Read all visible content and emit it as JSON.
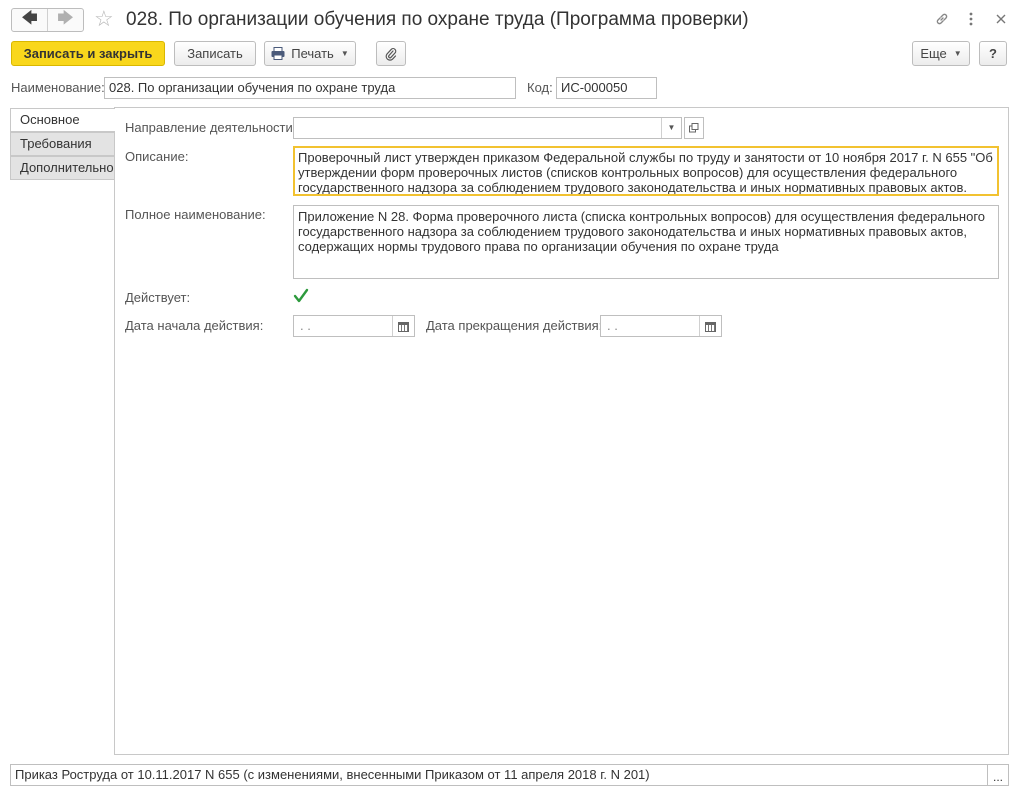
{
  "window": {
    "title": "028. По организации обучения по охране труда (Программа проверки)"
  },
  "icons": {
    "back": "arrow-left-icon",
    "forward": "arrow-right-icon",
    "favorite": "star-icon",
    "link": "link-icon",
    "menu": "more-vertical-icon",
    "close": "close-icon",
    "print": "printer-icon",
    "attach": "paperclip-icon",
    "calendar": "calendar-icon",
    "check": "checkmark-icon"
  },
  "toolbar": {
    "save_close": "Записать и закрыть",
    "save": "Записать",
    "print": "Печать",
    "more": "Еще",
    "help": "?"
  },
  "header": {
    "name_label": "Наименование:",
    "name_value": "028. По организации обучения по охране труда",
    "code_label": "Код:",
    "code_value": "ИС-000050"
  },
  "tabs": [
    {
      "label": "Основное",
      "active": true
    },
    {
      "label": "Требования",
      "active": false
    },
    {
      "label": "Дополнительно",
      "active": false
    }
  ],
  "form": {
    "direction_label": "Направление деятельности:",
    "direction_value": "",
    "description_label": "Описание:",
    "description_value": "Проверочный лист утвержден приказом Федеральной службы по труду и занятости от 10 ноября 2017 г. N 655 \"Об утверждении форм проверочных листов (списков контрольных вопросов) для осуществления федерального государственного надзора за соблюдением трудового законодательства и иных нормативных правовых актов.",
    "full_name_label": "Полное наименование:",
    "full_name_value": "Приложение N 28. Форма проверочного листа (списка контрольных вопросов) для осуществления федерального государственного надзора за соблюдением трудового законодательства и иных нормативных правовых актов, содержащих нормы трудового права по организации обучения по охране труда",
    "active_label": "Действует:",
    "active_value": true,
    "start_date_label": "Дата начала действия:",
    "start_date_value": " .  .",
    "end_date_label": "Дата прекращения действия:",
    "end_date_value": " .  ."
  },
  "footer": {
    "basis_value": "Приказ Роструда от 10.11.2017 N 655 (с изменениями, внесенными Приказом от 11 апреля 2018 г. N 201)",
    "select_button": "..."
  },
  "colors": {
    "primary": "#f9d71c",
    "focus_border": "#f2c230",
    "check": "#2d9a3d"
  }
}
